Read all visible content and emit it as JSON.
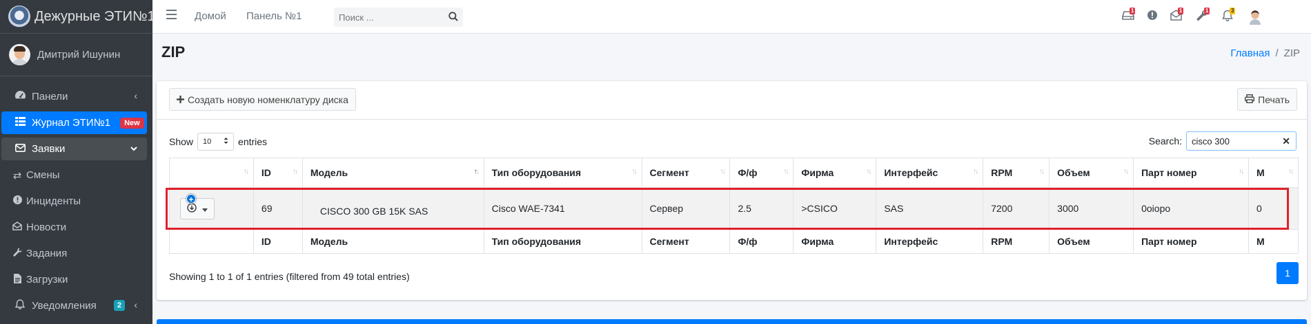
{
  "brand": {
    "title": "Дежурные ЭТИ№1"
  },
  "user": {
    "name": "Дмитрий Ишунин"
  },
  "sidebar": {
    "items": [
      {
        "label": "Панели",
        "icon": "tachometer-icon"
      },
      {
        "label": "Журнал ЭТИ№1",
        "icon": "grid-icon",
        "badge": "New"
      },
      {
        "label": "Заявки",
        "icon": "envelope-icon"
      },
      {
        "label": "Смены",
        "icon": "exchange-icon"
      },
      {
        "label": "Инциденты",
        "icon": "exclamation-circle-icon"
      },
      {
        "label": "Новости",
        "icon": "envelope-open-icon"
      },
      {
        "label": "Задания",
        "icon": "wrench-icon"
      },
      {
        "label": "Загрузки",
        "icon": "file-icon"
      },
      {
        "label": "Уведомления",
        "icon": "bell-icon",
        "badge": "2"
      }
    ]
  },
  "topbar": {
    "links": [
      "Домой",
      "Панель №1"
    ],
    "search_placeholder": "Поиск ...",
    "badges": {
      "drive": "1",
      "mail": "1",
      "tools": "1",
      "bell": "3"
    }
  },
  "page": {
    "title": "ZIP",
    "breadcrumb": {
      "home": "Главная",
      "current": "ZIP"
    }
  },
  "toolbar": {
    "create_label": "Создать новую номенклатуру диска",
    "print_label": "Печать"
  },
  "datatable": {
    "show_label": "Show",
    "length_value": "10",
    "entries_label": "entries",
    "search_label": "Search:",
    "search_value": "cisco 300",
    "columns": [
      "",
      "ID",
      "Модель",
      "Тип оборудования",
      "Сегмент",
      "Ф/ф",
      "Фирма",
      "Интерфейс",
      "RPM",
      "Объем",
      "Парт номер",
      "М"
    ],
    "rows": [
      {
        "id": "69",
        "model": "CISCO 300 GB 15K SAS",
        "type": "Cisco WAE-7341",
        "segment": "Сервер",
        "ff": "2.5",
        "firm": ">CSICO",
        "interface": "SAS",
        "rpm": "7200",
        "volume": "3000",
        "part": "0oiopo",
        "m": "0"
      }
    ],
    "info": "Showing 1 to 1 of 1 entries (filtered from 49 total entries)",
    "page": "1"
  },
  "colors": {
    "accent": "#007bff",
    "sidebar_bg": "#343a40",
    "highlight": "#e0202b",
    "badge_red": "#dc3545",
    "badge_warn": "#ffc107"
  }
}
